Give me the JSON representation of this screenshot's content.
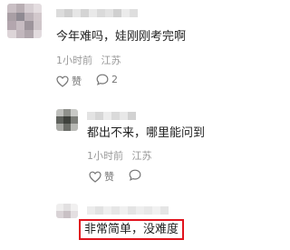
{
  "comments": [
    {
      "text": "今年难吗，娃刚刚考完啊",
      "time": "1小时前",
      "location": "江苏",
      "like_label": "赞",
      "reply_count": "2"
    }
  ],
  "replies": [
    {
      "text": "都出不来，哪里能问到",
      "time": "1小时前",
      "location": "江苏",
      "like_label": "赞"
    },
    {
      "text": "非常简单，没难度"
    }
  ],
  "colors": {
    "highlight_border": "#e0141e",
    "meta_text": "#999999"
  },
  "icons": [
    "heart-outline-icon",
    "comment-bubble-icon"
  ]
}
